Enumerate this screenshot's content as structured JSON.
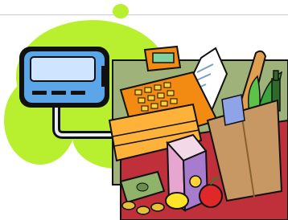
{
  "colors": {
    "blob": "#b8ef2e",
    "terminal_frame": "#111111",
    "terminal_body": "#5aa6e8",
    "terminal_screen": "#cfe4ff",
    "register_orange": "#f38b12",
    "register_yellow": "#ffd23a",
    "backdrop_red": "#c0303a",
    "backdrop_green": "#9fb27a",
    "bag_brown": "#c79863",
    "apple_red": "#e02828",
    "lemon_yellow": "#ffe329",
    "cash_green": "#8fb36b"
  },
  "icons": [
    "card-terminal-icon",
    "cash-register-icon",
    "receipt-icon",
    "grocery-bag-icon",
    "baguette-icon",
    "wine-bottle-icon",
    "milk-carton-icon",
    "apple-icon",
    "lemon-icon",
    "banknotes-icon",
    "coins-icon"
  ]
}
